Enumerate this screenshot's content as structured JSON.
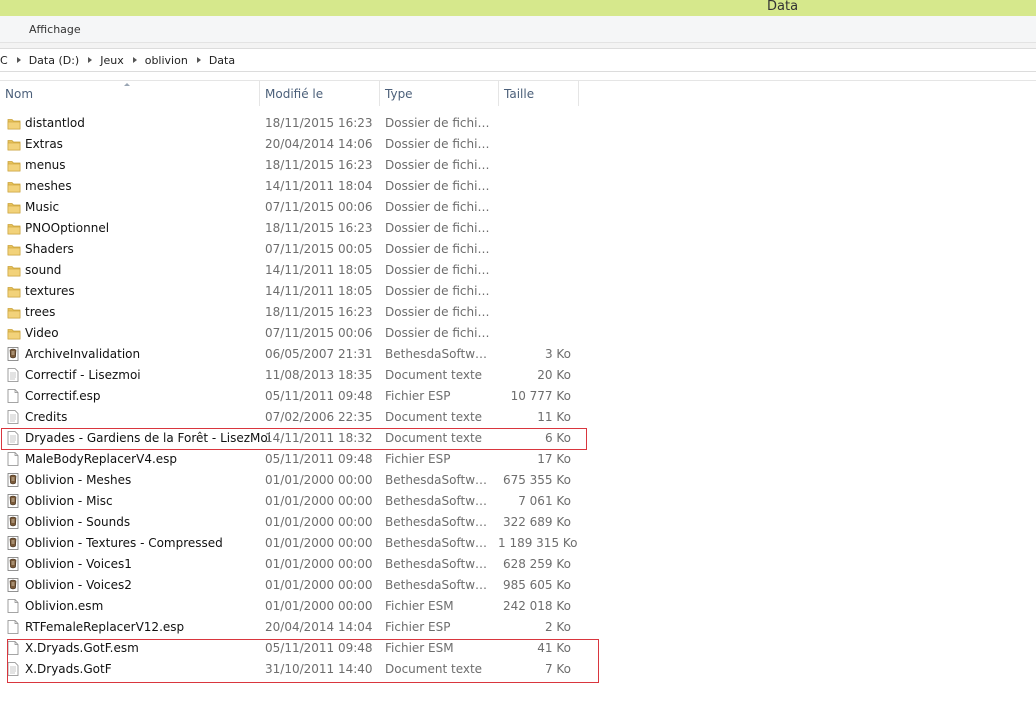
{
  "window": {
    "title": "Data"
  },
  "ribbon": {
    "tab_view": "Affichage"
  },
  "address": {
    "segments": [
      "C",
      "Data (D:)",
      "Jeux",
      "oblivion",
      "Data"
    ]
  },
  "columns": {
    "name": "Nom",
    "modified": "Modifié le",
    "type": "Type",
    "size": "Taille"
  },
  "files": [
    {
      "name": "distantlod",
      "date": "18/11/2015 16:23",
      "type": "Dossier de fichiers",
      "size": "",
      "icon": "folder-icon"
    },
    {
      "name": "Extras",
      "date": "20/04/2014 14:06",
      "type": "Dossier de fichiers",
      "size": "",
      "icon": "folder-icon"
    },
    {
      "name": "menus",
      "date": "18/11/2015 16:23",
      "type": "Dossier de fichiers",
      "size": "",
      "icon": "folder-icon"
    },
    {
      "name": "meshes",
      "date": "14/11/2011 18:04",
      "type": "Dossier de fichiers",
      "size": "",
      "icon": "folder-icon"
    },
    {
      "name": "Music",
      "date": "07/11/2015 00:06",
      "type": "Dossier de fichiers",
      "size": "",
      "icon": "folder-icon"
    },
    {
      "name": "PNOOptionnel",
      "date": "18/11/2015 16:23",
      "type": "Dossier de fichiers",
      "size": "",
      "icon": "folder-icon"
    },
    {
      "name": "Shaders",
      "date": "07/11/2015 00:05",
      "type": "Dossier de fichiers",
      "size": "",
      "icon": "folder-icon"
    },
    {
      "name": "sound",
      "date": "14/11/2011 18:05",
      "type": "Dossier de fichiers",
      "size": "",
      "icon": "folder-icon"
    },
    {
      "name": "textures",
      "date": "14/11/2011 18:05",
      "type": "Dossier de fichiers",
      "size": "",
      "icon": "folder-icon"
    },
    {
      "name": "trees",
      "date": "18/11/2015 16:23",
      "type": "Dossier de fichiers",
      "size": "",
      "icon": "folder-icon"
    },
    {
      "name": "Video",
      "date": "07/11/2015 00:06",
      "type": "Dossier de fichiers",
      "size": "",
      "icon": "folder-icon"
    },
    {
      "name": "ArchiveInvalidation",
      "date": "06/05/2007 21:31",
      "type": "BethesdaSoftwork...",
      "size": "3 Ko",
      "icon": "bethesda-file-icon"
    },
    {
      "name": "Correctif - Lisezmoi",
      "date": "11/08/2013 18:35",
      "type": "Document texte",
      "size": "20 Ko",
      "icon": "text-document-icon"
    },
    {
      "name": "Correctif.esp",
      "date": "05/11/2011 09:48",
      "type": "Fichier ESP",
      "size": "10 777 Ko",
      "icon": "file-icon"
    },
    {
      "name": "Credits",
      "date": "07/02/2006 22:35",
      "type": "Document texte",
      "size": "11 Ko",
      "icon": "text-document-icon"
    },
    {
      "name": "Dryades - Gardiens de la Forêt - LisezMoi",
      "date": "14/11/2011 18:32",
      "type": "Document texte",
      "size": "6 Ko",
      "icon": "text-document-icon"
    },
    {
      "name": "MaleBodyReplacerV4.esp",
      "date": "05/11/2011 09:48",
      "type": "Fichier ESP",
      "size": "17 Ko",
      "icon": "file-icon"
    },
    {
      "name": "Oblivion - Meshes",
      "date": "01/01/2000 00:00",
      "type": "BethesdaSoftwork...",
      "size": "675 355 Ko",
      "icon": "bethesda-file-icon"
    },
    {
      "name": "Oblivion - Misc",
      "date": "01/01/2000 00:00",
      "type": "BethesdaSoftwork...",
      "size": "7 061 Ko",
      "icon": "bethesda-file-icon"
    },
    {
      "name": "Oblivion - Sounds",
      "date": "01/01/2000 00:00",
      "type": "BethesdaSoftwork...",
      "size": "322 689 Ko",
      "icon": "bethesda-file-icon"
    },
    {
      "name": "Oblivion - Textures - Compressed",
      "date": "01/01/2000 00:00",
      "type": "BethesdaSoftwork...",
      "size": "1 189 315 Ko",
      "icon": "bethesda-file-icon"
    },
    {
      "name": "Oblivion - Voices1",
      "date": "01/01/2000 00:00",
      "type": "BethesdaSoftwork...",
      "size": "628 259 Ko",
      "icon": "bethesda-file-icon"
    },
    {
      "name": "Oblivion - Voices2",
      "date": "01/01/2000 00:00",
      "type": "BethesdaSoftwork...",
      "size": "985 605 Ko",
      "icon": "bethesda-file-icon"
    },
    {
      "name": "Oblivion.esm",
      "date": "01/01/2000 00:00",
      "type": "Fichier ESM",
      "size": "242 018 Ko",
      "icon": "file-icon"
    },
    {
      "name": "RTFemaleReplacerV12.esp",
      "date": "20/04/2014 14:04",
      "type": "Fichier ESP",
      "size": "2 Ko",
      "icon": "file-icon"
    },
    {
      "name": "X.Dryads.GotF.esm",
      "date": "05/11/2011 09:48",
      "type": "Fichier ESM",
      "size": "41 Ko",
      "icon": "file-icon"
    },
    {
      "name": "X.Dryads.GotF",
      "date": "31/10/2011 14:40",
      "type": "Document texte",
      "size": "7 Ko",
      "icon": "text-document-icon"
    }
  ],
  "colors": {
    "titlebar": "#d6e88c",
    "highlight": "#d9363e",
    "folder": "#e8c35a",
    "header_text": "#4c607a"
  }
}
